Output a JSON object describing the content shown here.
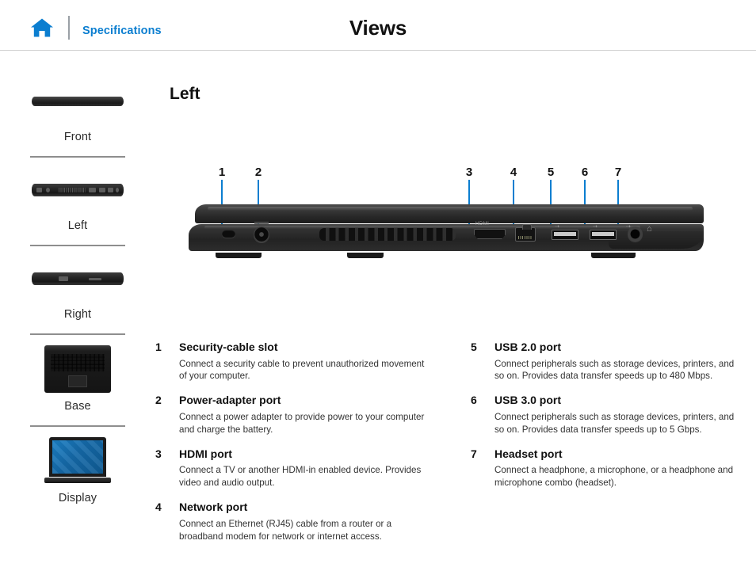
{
  "header": {
    "home_icon": "home-icon",
    "breadcrumb": "Specifications",
    "title": "Views"
  },
  "sidebar": {
    "items": [
      {
        "label": "Front",
        "thumb": "laptop-front-thumbnail"
      },
      {
        "label": "Left",
        "thumb": "laptop-left-thumbnail"
      },
      {
        "label": "Right",
        "thumb": "laptop-right-thumbnail"
      },
      {
        "label": "Base",
        "thumb": "laptop-base-thumbnail"
      },
      {
        "label": "Display",
        "thumb": "laptop-display-thumbnail"
      }
    ]
  },
  "main": {
    "section_title": "Left",
    "callouts": [
      {
        "num": "1"
      },
      {
        "num": "2"
      },
      {
        "num": "3"
      },
      {
        "num": "4"
      },
      {
        "num": "5"
      },
      {
        "num": "6"
      },
      {
        "num": "7"
      }
    ],
    "port_labels": {
      "hdmi": "HDMI",
      "usb5": "⇢",
      "usb6": "⇢",
      "usb7": "⇢",
      "jack": "⌂"
    },
    "items_left": [
      {
        "num": "1",
        "title": "Security-cable slot",
        "desc": "Connect a security cable to prevent unauthorized movement of your computer."
      },
      {
        "num": "2",
        "title": "Power-adapter port",
        "desc": "Connect a power adapter to provide power to your computer and charge the battery."
      },
      {
        "num": "3",
        "title": "HDMI port",
        "desc": "Connect a TV or another HDMI-in enabled device. Provides video and audio output."
      },
      {
        "num": "4",
        "title": "Network port",
        "desc": "Connect an Ethernet (RJ45) cable from a router or a broadband modem for network or internet access."
      }
    ],
    "items_right": [
      {
        "num": "5",
        "title": "USB 2.0 port",
        "desc": "Connect peripherals such as storage devices, printers, and so on. Provides data transfer speeds up to 480 Mbps."
      },
      {
        "num": "6",
        "title": "USB 3.0 port",
        "desc": "Connect peripherals such as storage devices, printers, and so on. Provides data transfer speeds up to 5 Gbps."
      },
      {
        "num": "7",
        "title": "Headset port",
        "desc": "Connect a headphone, a microphone, or a headphone and microphone combo (headset)."
      }
    ]
  },
  "colors": {
    "accent_blue": "#0b7ed0",
    "leader_line": "#0b7ed0",
    "text": "#111111",
    "body_text": "#333333",
    "divider": "#d0d0d0",
    "sidebar_separator": "#8e8e8e",
    "chassis_dark": "#232323",
    "screen_blue": "#1569a8"
  }
}
